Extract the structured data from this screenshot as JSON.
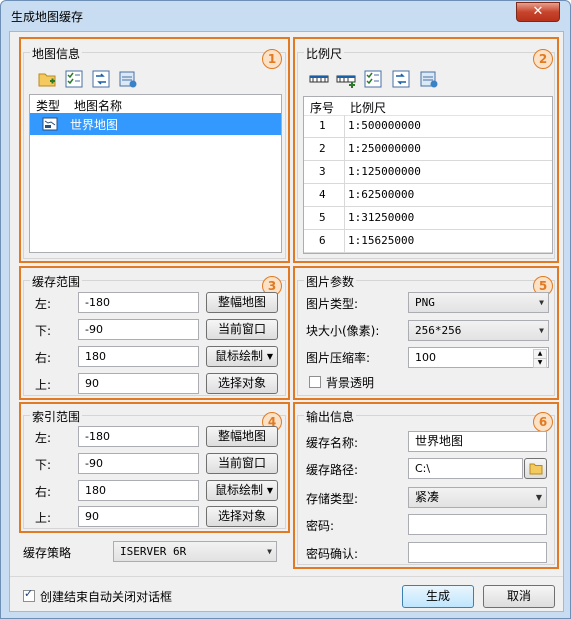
{
  "window": {
    "title": "生成地图缓存",
    "close_label": "✕"
  },
  "panel1": {
    "badge": "1",
    "group_title": "地图信息",
    "toolbar_icons": [
      "open-folder-icon",
      "select-all-icon",
      "invert-selection-icon",
      "map-settings-icon"
    ],
    "columns": [
      "类型",
      "地图名称"
    ],
    "rows": [
      {
        "type_icon": "map-icon",
        "name": "世界地图",
        "selected": true
      }
    ]
  },
  "panel2": {
    "badge": "2",
    "group_title": "比例尺",
    "toolbar_icons": [
      "scale-icon",
      "add-scale-icon",
      "select-all-icon",
      "invert-selection-icon",
      "map-settings-icon"
    ],
    "columns": [
      "序号",
      "比例尺"
    ],
    "rows": [
      {
        "index": "1",
        "scale": "1:500000000"
      },
      {
        "index": "2",
        "scale": "1:250000000"
      },
      {
        "index": "3",
        "scale": "1:125000000"
      },
      {
        "index": "4",
        "scale": "1:62500000"
      },
      {
        "index": "5",
        "scale": "1:31250000"
      },
      {
        "index": "6",
        "scale": "1:15625000"
      }
    ]
  },
  "panel3": {
    "badge": "3",
    "group_title": "缓存范围",
    "left_label": "左:",
    "left_value": "-180",
    "bottom_label": "下:",
    "bottom_value": "-90",
    "right_label": "右:",
    "right_value": "180",
    "top_label": "上:",
    "top_value": "90",
    "btn_full": "整幅地图",
    "btn_current": "当前窗口",
    "btn_mouse": "鼠标绘制",
    "btn_select": "选择对象"
  },
  "panel4": {
    "badge": "4",
    "group_title": "索引范围",
    "left_label": "左:",
    "left_value": "-180",
    "bottom_label": "下:",
    "bottom_value": "-90",
    "right_label": "右:",
    "right_value": "180",
    "top_label": "上:",
    "top_value": "90",
    "btn_full": "整幅地图",
    "btn_current": "当前窗口",
    "btn_mouse": "鼠标绘制",
    "btn_select": "选择对象"
  },
  "strategy": {
    "label": "缓存策略",
    "value": "ISERVER 6R"
  },
  "panel5": {
    "badge": "5",
    "group_title": "图片参数",
    "type_label": "图片类型:",
    "type_value": "PNG",
    "size_label": "块大小(像素):",
    "size_value": "256*256",
    "compress_label": "图片压缩率:",
    "compress_value": "100",
    "transparent_label": "背景透明",
    "transparent_checked": false
  },
  "panel6": {
    "badge": "6",
    "group_title": "输出信息",
    "name_label": "缓存名称:",
    "name_value": "世界地图",
    "path_label": "缓存路径:",
    "path_value": "C:\\",
    "storage_label": "存储类型:",
    "storage_value": "紧凑",
    "pwd_label": "密码:",
    "pwd_value": "",
    "pwd_confirm_label": "密码确认:",
    "pwd_confirm_value": ""
  },
  "footer": {
    "auto_close_label": "创建结束自动关闭对话框",
    "auto_close_checked": true,
    "generate_label": "生成",
    "cancel_label": "取消"
  }
}
